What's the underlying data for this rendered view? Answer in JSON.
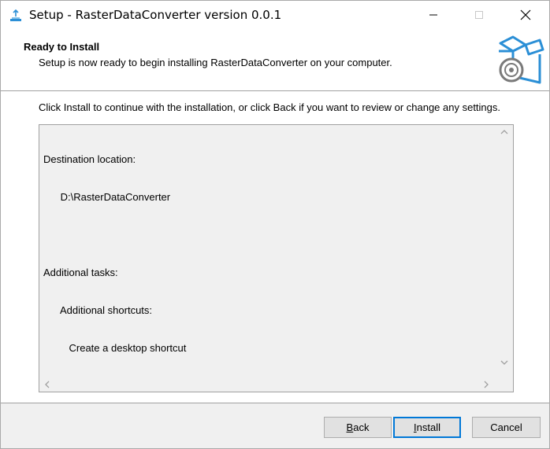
{
  "window": {
    "title": "Setup - RasterDataConverter version 0.0.1"
  },
  "header": {
    "title": "Ready to Install",
    "subtitle": "Setup is now ready to begin installing RasterDataConverter on your computer."
  },
  "body": {
    "instruction": "Click Install to continue with the installation, or click Back if you want to review or change any settings.",
    "memo_lines": [
      "Destination location:",
      "      D:\\RasterDataConverter",
      "",
      "Additional tasks:",
      "      Additional shortcuts:",
      "         Create a desktop shortcut"
    ]
  },
  "buttons": {
    "back_accel": "B",
    "back_rest": "ack",
    "install_accel": "I",
    "install_rest": "nstall",
    "cancel": "Cancel"
  },
  "icons": {
    "app": "setup-icon",
    "logo": "install-box-icon",
    "minimize": "minimize-icon",
    "maximize": "maximize-icon",
    "close": "close-icon"
  },
  "colors": {
    "accent": "#0078d7",
    "logo": "#2b8fd6"
  }
}
